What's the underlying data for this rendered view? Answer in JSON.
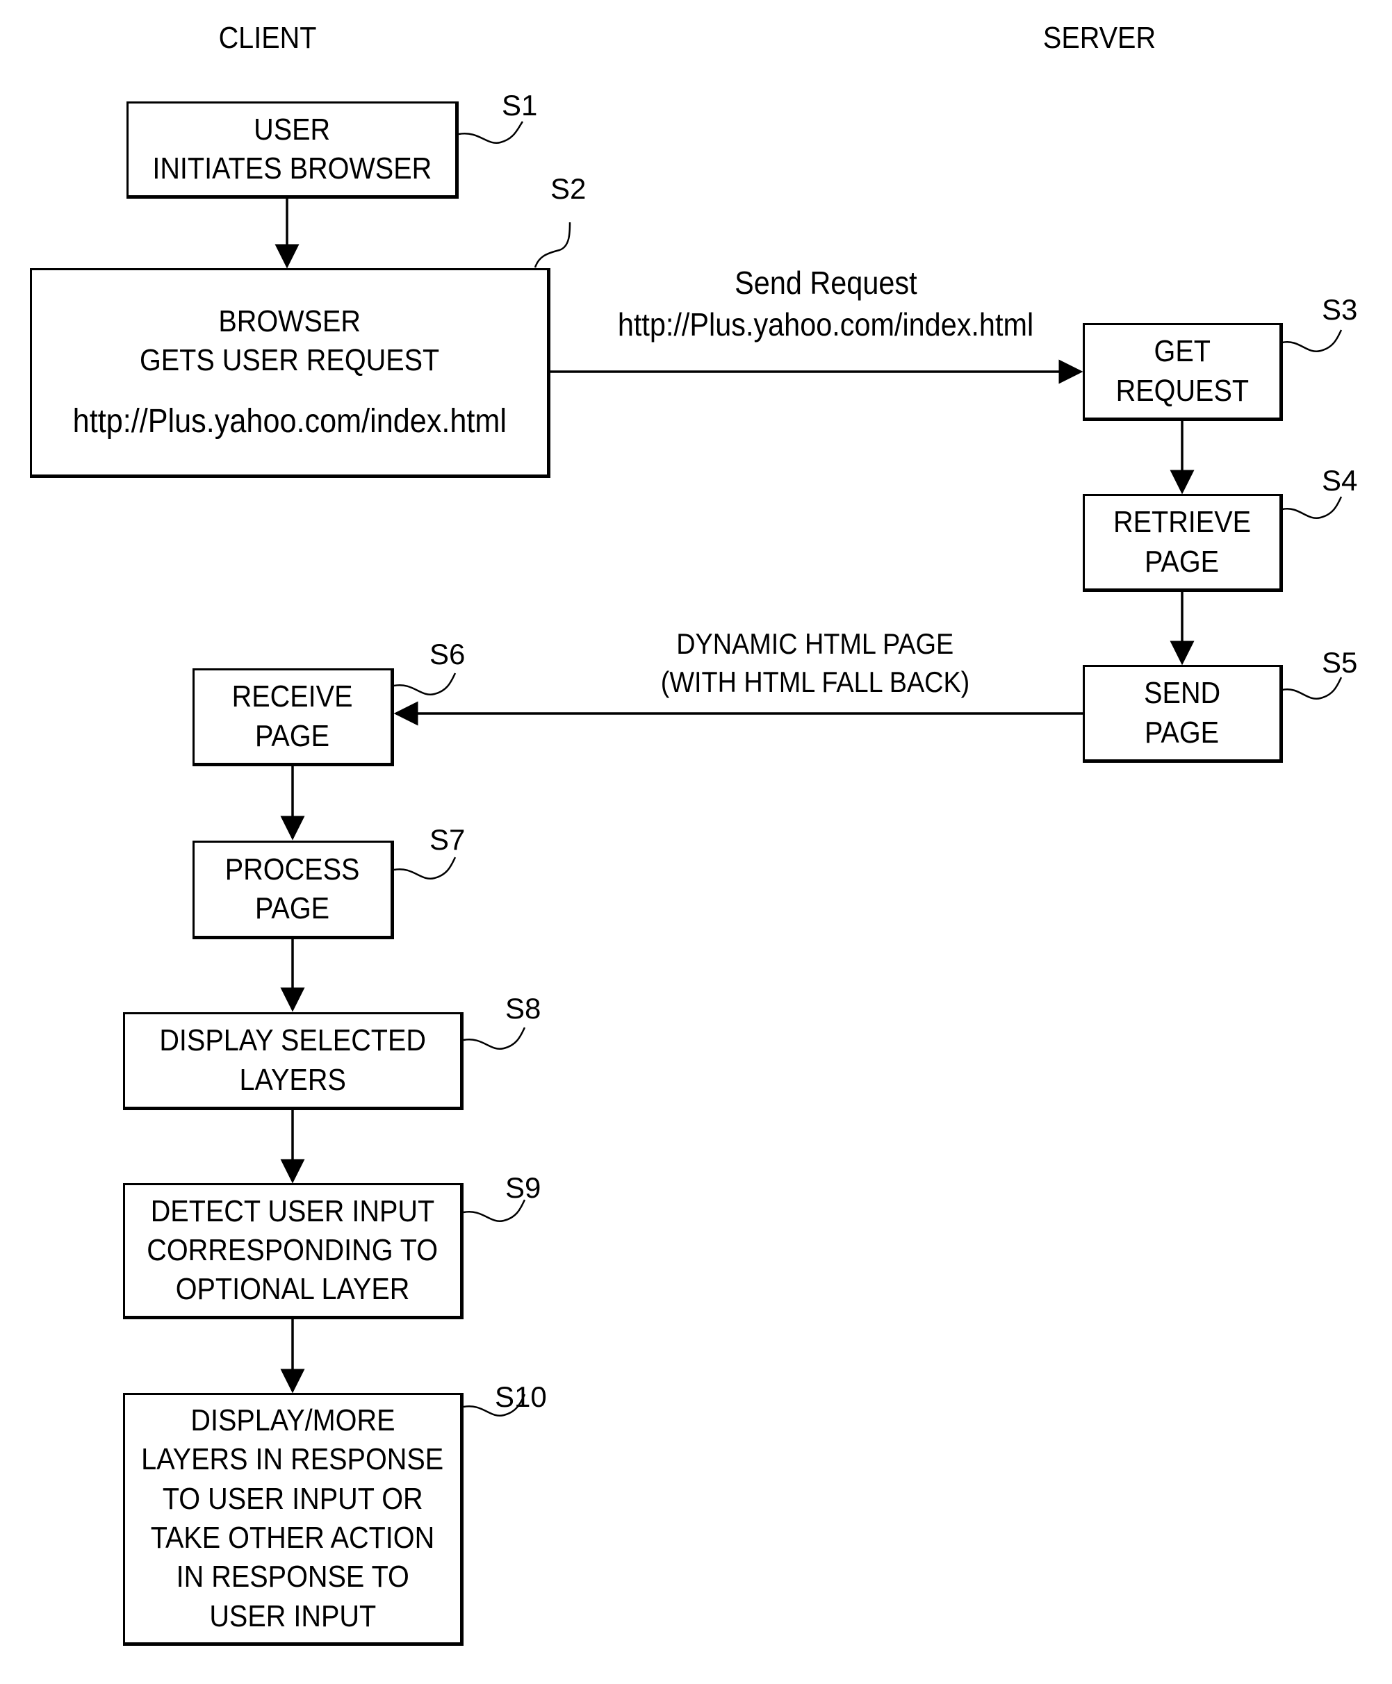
{
  "headers": {
    "client": "CLIENT",
    "server": "SERVER"
  },
  "steps": [
    {
      "id": "S1",
      "lines": [
        "USER",
        "INITIATES BROWSER"
      ]
    },
    {
      "id": "S2",
      "lines": [
        "BROWSER",
        "GETS USER REQUEST"
      ],
      "url": "http://Plus.yahoo.com/index.html"
    },
    {
      "id": "S3",
      "lines": [
        "GET",
        "REQUEST"
      ]
    },
    {
      "id": "S4",
      "lines": [
        "RETRIEVE",
        "PAGE"
      ]
    },
    {
      "id": "S5",
      "lines": [
        "SEND",
        "PAGE"
      ]
    },
    {
      "id": "S6",
      "lines": [
        "RECEIVE",
        "PAGE"
      ]
    },
    {
      "id": "S7",
      "lines": [
        "PROCESS",
        "PAGE"
      ]
    },
    {
      "id": "S8",
      "lines": [
        "DISPLAY SELECTED",
        "LAYERS"
      ]
    },
    {
      "id": "S9",
      "lines": [
        "DETECT USER INPUT",
        "CORRESPONDING TO",
        "OPTIONAL LAYER"
      ]
    },
    {
      "id": "S10",
      "lines": [
        "DISPLAY/MORE",
        "LAYERS IN RESPONSE",
        "TO USER INPUT OR",
        "TAKE OTHER ACTION",
        "IN RESPONSE TO",
        "USER INPUT"
      ]
    }
  ],
  "edges": {
    "request": {
      "line1": "Send Request",
      "line2": "http://Plus.yahoo.com/index.html"
    },
    "response": {
      "line1": "DYNAMIC HTML PAGE",
      "line2": "(WITH HTML FALL BACK)"
    }
  }
}
